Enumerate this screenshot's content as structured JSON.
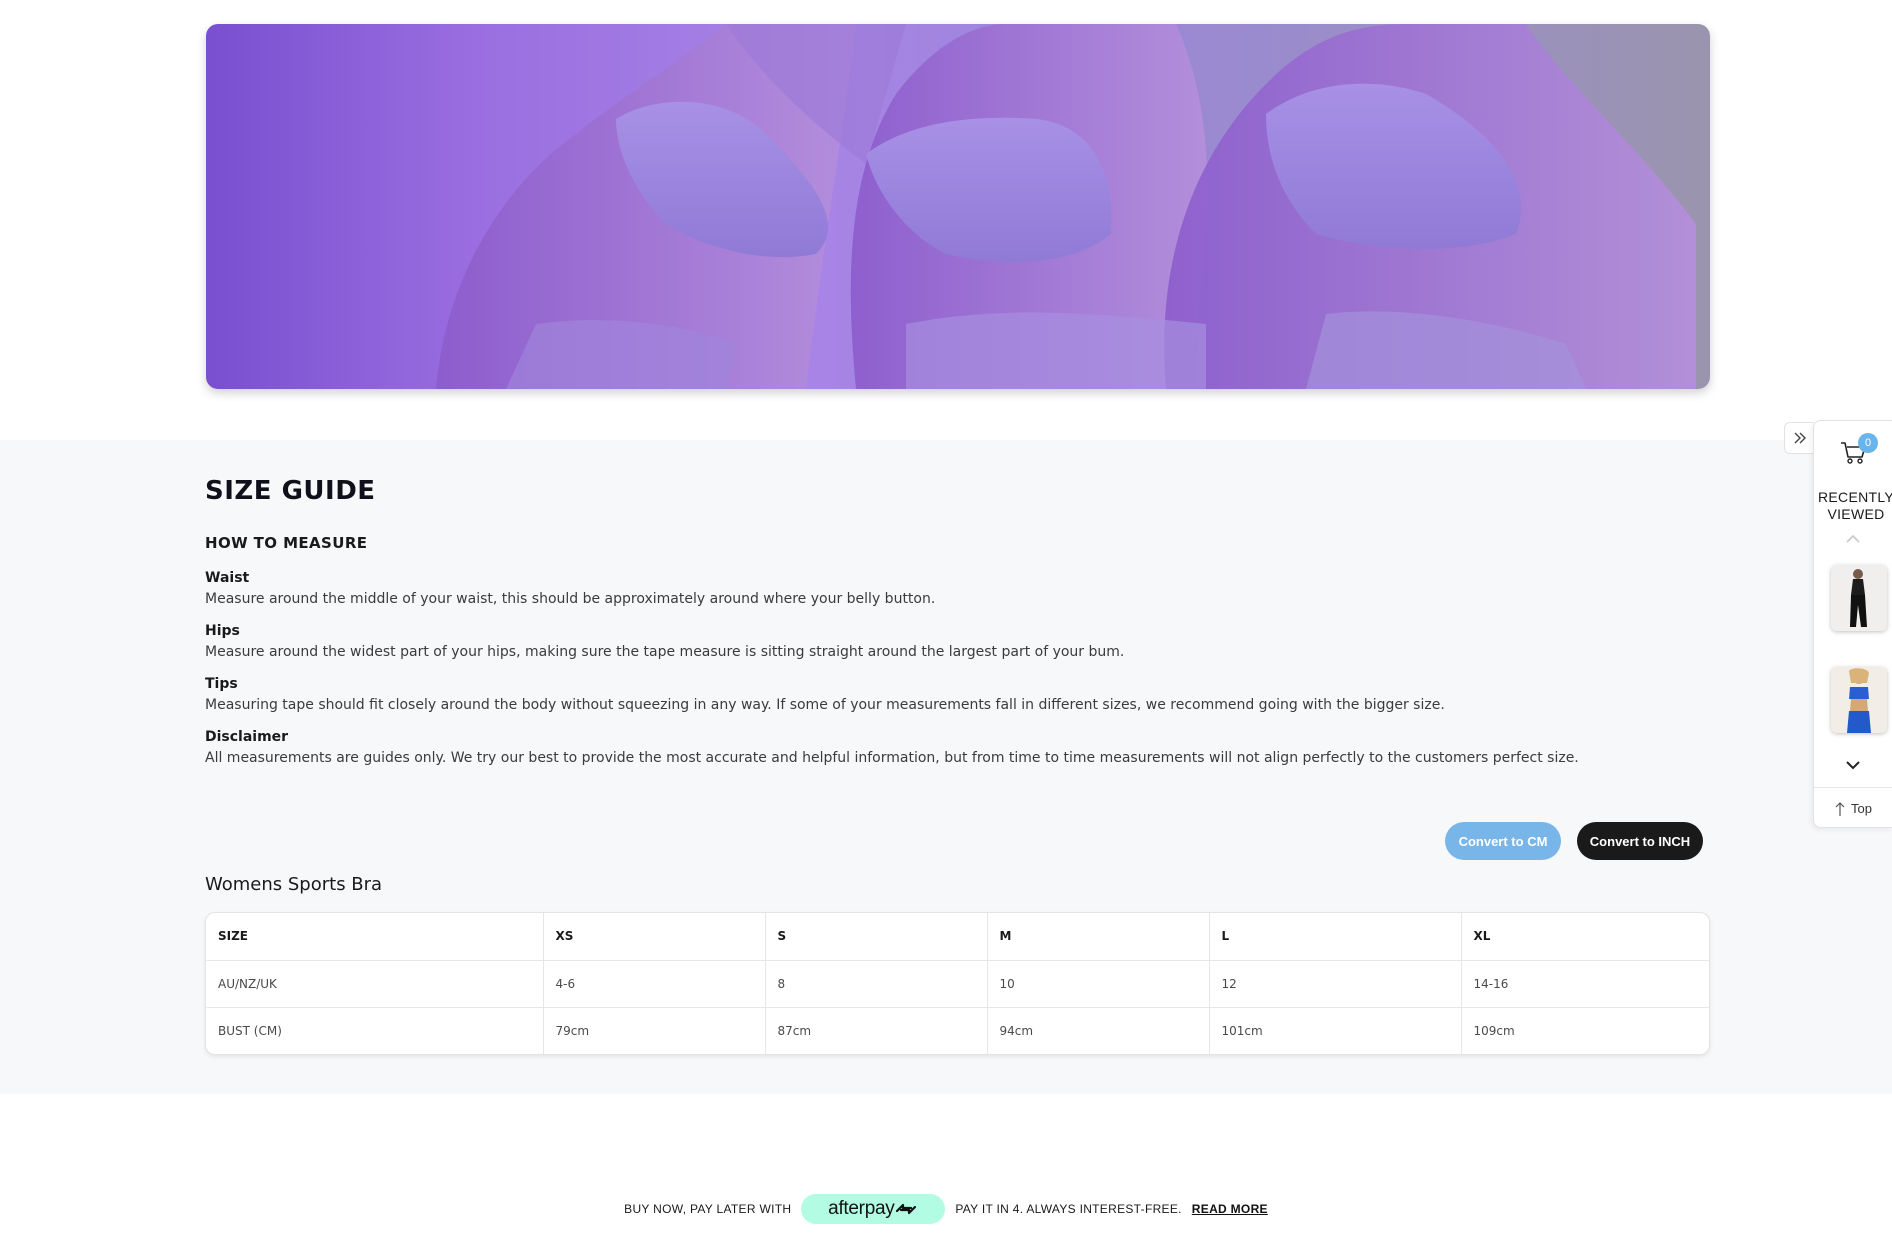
{
  "size_guide": {
    "title": "SIZE GUIDE",
    "how_to_measure": "HOW TO MEASURE",
    "items": [
      {
        "heading": "Waist",
        "text": "Measure around the middle of your waist, this should be approximately around where your belly button."
      },
      {
        "heading": "Hips",
        "text": "Measure around the widest part of your hips, making sure the tape measure is sitting straight around the largest part of your bum."
      },
      {
        "heading": "Tips",
        "text": "Measuring tape should fit closely around the body without squeezing in any way. If some of your measurements fall in different sizes, we recommend going with the bigger size."
      },
      {
        "heading": "Disclaimer",
        "text": "All measurements are guides only. We try our best to provide the most accurate and helpful information, but from time to time measurements will not align perfectly to the customers perfect size."
      }
    ],
    "convert_cm": "Convert to CM",
    "convert_inch": "Convert to INCH"
  },
  "table": {
    "title": "Womens Sports Bra",
    "header": [
      "SIZE",
      "XS",
      "S",
      "M",
      "L",
      "XL"
    ],
    "rows": [
      [
        "AU/NZ/UK",
        "4-6",
        "8",
        "10",
        "12",
        "14-16"
      ],
      [
        "BUST (CM)",
        "79cm",
        "87cm",
        "94cm",
        "101cm",
        "109cm"
      ]
    ]
  },
  "afterpay": {
    "prefix": "BUY NOW, PAY LATER WITH",
    "logo": "afterpay",
    "suffix": "PAY IT IN 4. ALWAYS INTEREST-FREE.",
    "read_more": "READ MORE"
  },
  "widget": {
    "cart_count": "0",
    "recently_viewed": "RECENTLY VIEWED",
    "top": "Top"
  },
  "colors": {
    "accent_blue": "#78b6ea",
    "dark": "#1a1a1a",
    "afterpay_mint": "#b2fce4"
  }
}
